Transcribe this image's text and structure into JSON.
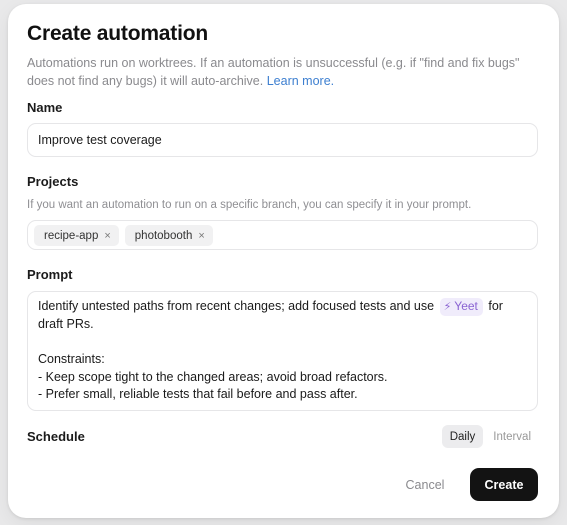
{
  "dialog": {
    "title": "Create automation",
    "description": "Automations run on worktrees. If an automation is unsuccessful (e.g. if \"find and fix bugs\" does not find any bugs) it will auto-archive. ",
    "learn_more": "Learn more."
  },
  "name": {
    "label": "Name",
    "value": "Improve test coverage"
  },
  "projects": {
    "label": "Projects",
    "hint": "If you want an automation to run on a specific branch, you can specify it in your prompt.",
    "chips": [
      {
        "label": "recipe-app",
        "remove_glyph": "×"
      },
      {
        "label": "photobooth",
        "remove_glyph": "×"
      }
    ]
  },
  "prompt": {
    "label": "Prompt",
    "line1_before": "Identify untested paths from recent changes; add focused tests and use ",
    "token_icon": "⚡",
    "token_label": "Yeet",
    "line1_after": " for",
    "line2": "draft PRs.",
    "line3": "",
    "line4": "Constraints:",
    "line5": "- Keep scope tight to the changed areas; avoid broad refactors.",
    "line6": "- Prefer small, reliable tests that fail before and pass after.",
    "token_icon_name": "lightning-icon"
  },
  "schedule": {
    "label": "Schedule",
    "options": [
      "Daily",
      "Interval"
    ],
    "selected": "Daily"
  },
  "actions": {
    "cancel": "Cancel",
    "create": "Create"
  },
  "colors": {
    "accent_link": "#3d7fd0",
    "token_bg": "#f0ecfb",
    "token_fg": "#8a63d2",
    "primary_button": "#131313"
  }
}
